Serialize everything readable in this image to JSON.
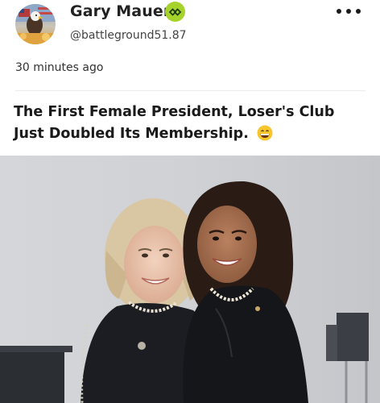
{
  "post": {
    "author": {
      "name": "Gary Mauer",
      "handle": "@battleground51.87",
      "avatar_icon": "eagle-flag-avatar",
      "badge_icon": "verified-badge-icon",
      "badge_color": "#a6d22a"
    },
    "timestamp": "30 minutes ago",
    "menu_icon": "more-options-icon",
    "text": "The First Female President, Loser's Club Just Doubled Its Membership.",
    "emoji": "grinning-face-emoji",
    "image": {
      "subject": "photo-of-two-women-in-dark-suits"
    }
  }
}
